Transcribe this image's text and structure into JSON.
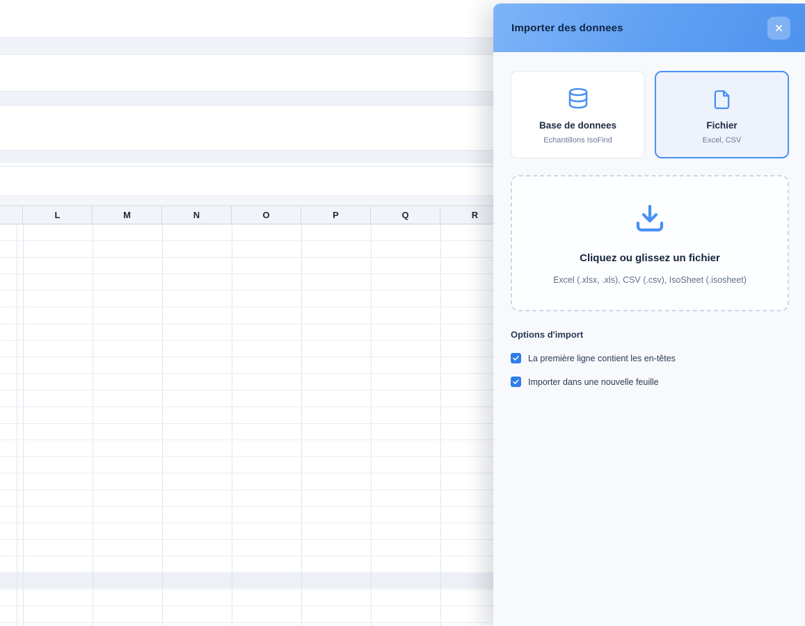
{
  "panel": {
    "title": "Importer des donnees",
    "sources": [
      {
        "title": "Base de donnees",
        "subtitle": "Echantillons IsoFind",
        "icon": "database-icon",
        "selected": false
      },
      {
        "title": "Fichier",
        "subtitle": "Excel, CSV",
        "icon": "file-icon",
        "selected": true
      }
    ],
    "dropzone": {
      "title": "Cliquez ou glissez un fichier",
      "subtitle": "Excel (.xlsx, .xls), CSV (.csv), IsoSheet (.isosheet)",
      "icon": "download-icon"
    },
    "options": {
      "heading": "Options d'import",
      "items": [
        {
          "label": "La première ligne contient les en-têtes",
          "checked": true
        },
        {
          "label": "Importer dans une nouvelle feuille",
          "checked": true
        }
      ]
    }
  },
  "spreadsheet": {
    "visible_columns": [
      "L",
      "M",
      "N",
      "O",
      "P",
      "Q",
      "R"
    ]
  },
  "colors": {
    "accent": "#4a90f4",
    "panel_header_gradient_start": "#7eb4f8",
    "panel_header_gradient_end": "#4f93ee",
    "checkbox_blue": "#2e7ceb",
    "panel_background": "#f7f9fc",
    "column_header_background": "#f1f4f8",
    "grid_line": "#e7ebf2"
  }
}
